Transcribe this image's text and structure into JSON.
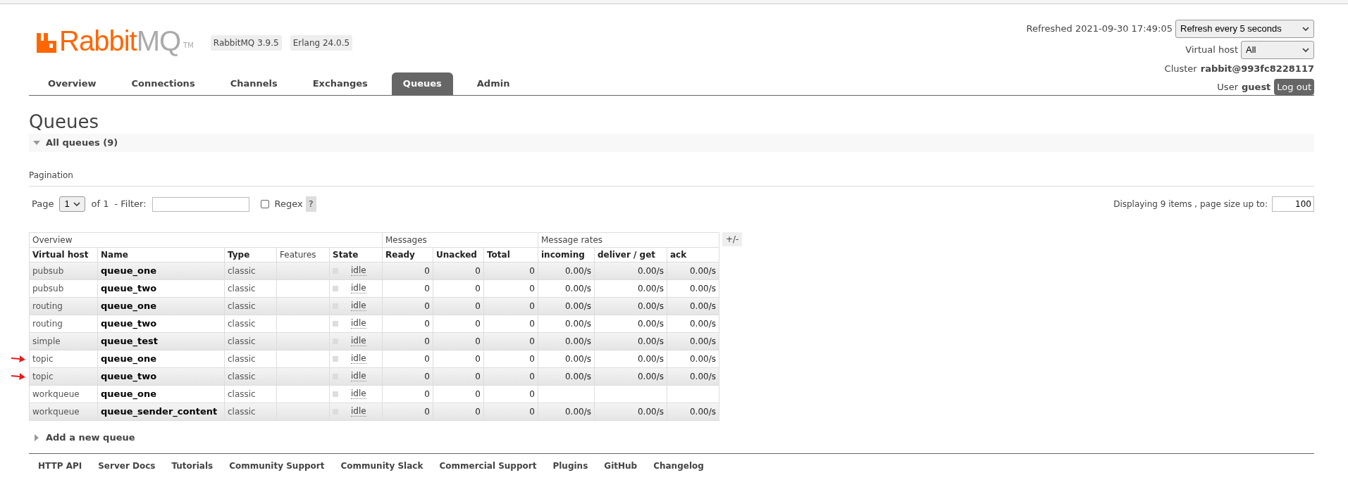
{
  "header": {
    "logo_word": "RabbitMQ",
    "logo_tm": "TM",
    "versions": [
      "RabbitMQ 3.9.5",
      "Erlang 24.0.5"
    ],
    "refreshed_label": "Refreshed 2021-09-30 17:49:05",
    "refresh_select": "Refresh every 5 seconds",
    "vhost_label": "Virtual host",
    "vhost_select": "All",
    "cluster_label": "Cluster",
    "cluster_name": "rabbit@993fc8228117",
    "user_label": "User",
    "user_name": "guest",
    "logout": "Log out"
  },
  "tabs": [
    {
      "label": "Overview",
      "selected": false
    },
    {
      "label": "Connections",
      "selected": false
    },
    {
      "label": "Channels",
      "selected": false
    },
    {
      "label": "Exchanges",
      "selected": false
    },
    {
      "label": "Queues",
      "selected": true
    },
    {
      "label": "Admin",
      "selected": false
    }
  ],
  "page_title": "Queues",
  "section": {
    "title": "All queues (9)",
    "expanded": true
  },
  "pagination": {
    "heading": "Pagination",
    "page_label": "Page",
    "page_value": "1",
    "of_label": "of 1",
    "filter_label": "- Filter:",
    "regex_label": "Regex",
    "regex_checked": false,
    "help": "?",
    "displaying": "Displaying 9 items , page size up to:",
    "page_size": "100"
  },
  "table": {
    "groups": [
      "Overview",
      "Messages",
      "Message rates"
    ],
    "columns": [
      "Virtual host",
      "Name",
      "Type",
      "Features",
      "State",
      "Ready",
      "Unacked",
      "Total",
      "incoming",
      "deliver / get",
      "ack"
    ],
    "toggle": "+/-",
    "rows": [
      {
        "vhost": "pubsub",
        "name": "queue_one",
        "type": "classic",
        "state": "idle",
        "ready": "0",
        "unacked": "0",
        "total": "0",
        "incoming": "0.00/s",
        "deliver": "0.00/s",
        "ack": "0.00/s",
        "marked": false
      },
      {
        "vhost": "pubsub",
        "name": "queue_two",
        "type": "classic",
        "state": "idle",
        "ready": "0",
        "unacked": "0",
        "total": "0",
        "incoming": "0.00/s",
        "deliver": "0.00/s",
        "ack": "0.00/s",
        "marked": false
      },
      {
        "vhost": "routing",
        "name": "queue_one",
        "type": "classic",
        "state": "idle",
        "ready": "0",
        "unacked": "0",
        "total": "0",
        "incoming": "0.00/s",
        "deliver": "0.00/s",
        "ack": "0.00/s",
        "marked": false
      },
      {
        "vhost": "routing",
        "name": "queue_two",
        "type": "classic",
        "state": "idle",
        "ready": "0",
        "unacked": "0",
        "total": "0",
        "incoming": "0.00/s",
        "deliver": "0.00/s",
        "ack": "0.00/s",
        "marked": false
      },
      {
        "vhost": "simple",
        "name": "queue_test",
        "type": "classic",
        "state": "idle",
        "ready": "0",
        "unacked": "0",
        "total": "0",
        "incoming": "0.00/s",
        "deliver": "0.00/s",
        "ack": "0.00/s",
        "marked": false
      },
      {
        "vhost": "topic",
        "name": "queue_one",
        "type": "classic",
        "state": "idle",
        "ready": "0",
        "unacked": "0",
        "total": "0",
        "incoming": "0.00/s",
        "deliver": "0.00/s",
        "ack": "0.00/s",
        "marked": true
      },
      {
        "vhost": "topic",
        "name": "queue_two",
        "type": "classic",
        "state": "idle",
        "ready": "0",
        "unacked": "0",
        "total": "0",
        "incoming": "0.00/s",
        "deliver": "0.00/s",
        "ack": "0.00/s",
        "marked": true
      },
      {
        "vhost": "workqueue",
        "name": "queue_one",
        "type": "classic",
        "state": "idle",
        "ready": "0",
        "unacked": "0",
        "total": "0",
        "marked": false
      },
      {
        "vhost": "workqueue",
        "name": "queue_sender_content",
        "type": "classic",
        "state": "idle",
        "ready": "0",
        "unacked": "0",
        "total": "0",
        "incoming": "0.00/s",
        "deliver": "0.00/s",
        "ack": "0.00/s",
        "marked": false
      }
    ]
  },
  "add_section": {
    "title": "Add a new queue",
    "expanded": false
  },
  "footer": [
    "HTTP API",
    "Server Docs",
    "Tutorials",
    "Community Support",
    "Community Slack",
    "Commercial Support",
    "Plugins",
    "GitHub",
    "Changelog"
  ]
}
